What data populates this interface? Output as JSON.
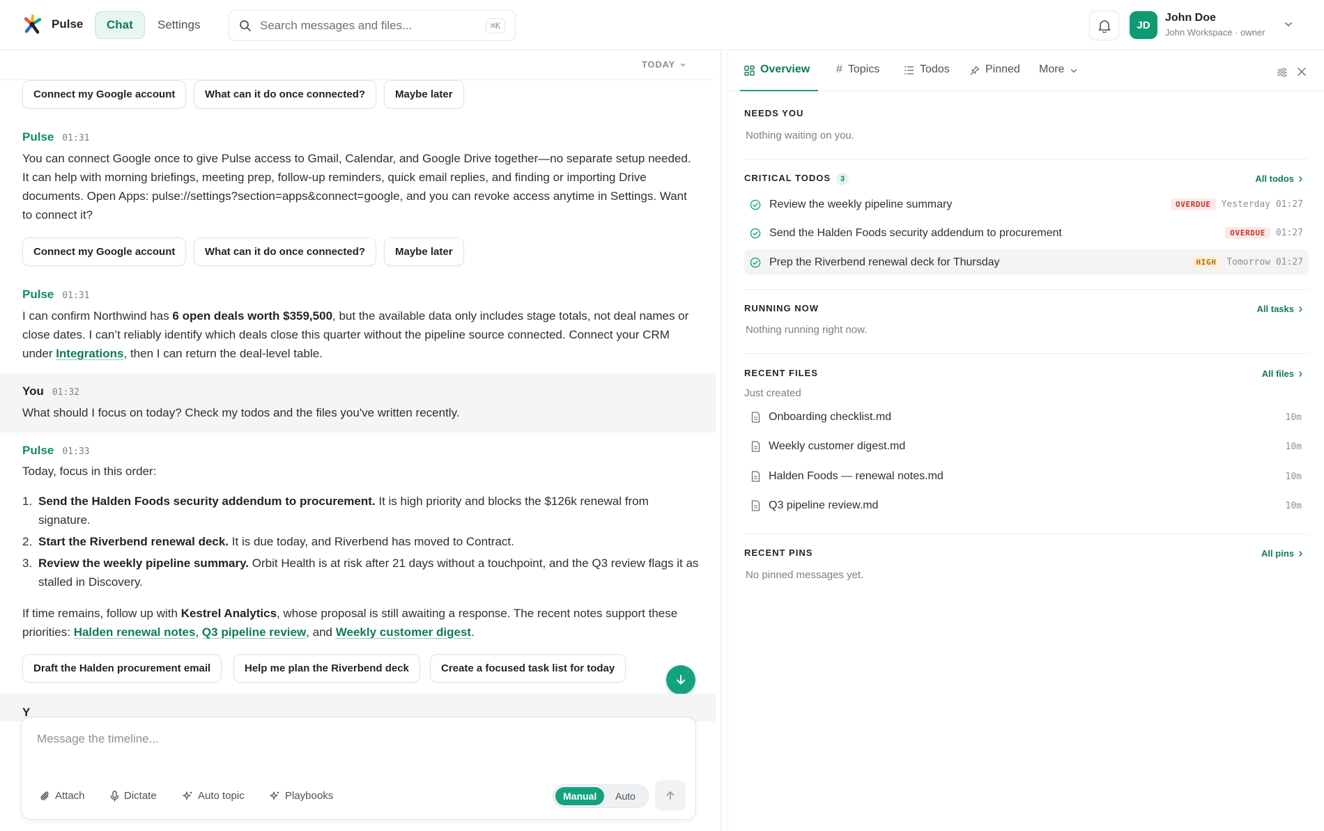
{
  "app": {
    "name": "Pulse",
    "brand_colors": [
      "#ef4b3f",
      "#f5b625",
      "#14a37e",
      "#2f64d8",
      "#1f2328"
    ]
  },
  "nav": {
    "tabs": [
      {
        "label": "Chat",
        "active": true
      },
      {
        "label": "Settings",
        "active": false
      }
    ]
  },
  "search": {
    "placeholder": "Search messages and files...",
    "shortcut": "⌘K"
  },
  "user": {
    "initials": "JD",
    "name": "John Doe",
    "subtitle": "John Workspace · owner"
  },
  "chat": {
    "date_label": "TODAY",
    "chips_top": [
      "Connect my Google account",
      "What can it do once connected?",
      "Maybe later"
    ],
    "msg1": {
      "sender": "Pulse",
      "time": "01:31",
      "text": "You can connect Google once to give Pulse access to Gmail, Calendar, and Google Drive together—no separate setup needed. It can help with morning briefings, meeting prep, follow-up reminders, quick email replies, and finding or importing Drive documents. Open Apps: pulse://settings?section=apps&connect=google, and you can revoke access anytime in Settings. Want to connect it?",
      "chips": [
        "Connect my Google account",
        "What can it do once connected?",
        "Maybe later"
      ]
    },
    "msg2": {
      "sender": "Pulse",
      "time": "01:31",
      "t1": "I can confirm Northwind has ",
      "bold": "6 open deals worth $359,500",
      "t2": ", but the available data only includes stage totals, not deal names or close dates. I can’t reliably identify which deals close this quarter without the pipeline source connected. Connect your CRM under ",
      "link": "Integrations",
      "t3": ", then I can return the deal-level table."
    },
    "msg3": {
      "sender": "You",
      "time": "01:32",
      "text": "What should I focus on today? Check my todos and the files you've written recently."
    },
    "msg4": {
      "sender": "Pulse",
      "time": "01:33",
      "intro": "Today, focus in this order:",
      "items": [
        {
          "n": "1.",
          "bold": "Send the Halden Foods security addendum to procurement.",
          "rest": " It is high priority and blocks the $126k renewal from signature."
        },
        {
          "n": "2.",
          "bold": "Start the Riverbend renewal deck.",
          "rest": " It is due today, and Riverbend has moved to Contract."
        },
        {
          "n": "3.",
          "bold": "Review the weekly pipeline summary.",
          "rest": " Orbit Health is at risk after 21 days without a touchpoint, and the Q3 review flags it as stalled in Discovery."
        }
      ],
      "outro_a": "If time remains, follow up with ",
      "outro_bold": "Kestrel Analytics",
      "outro_b": ", whose proposal is still awaiting a response. The recent notes support these priorities: ",
      "link1": "Halden renewal notes",
      "sep1": ", ",
      "link2": "Q3 pipeline review",
      "sep2": ", and ",
      "link3": "Weekly customer digest",
      "end": ".",
      "chips": [
        "Draft the Halden procurement email",
        "Help me plan the Riverbend deck",
        "Create a focused task list for today"
      ]
    },
    "partial_sender": "Y"
  },
  "composer": {
    "placeholder": "Message the timeline...",
    "tools": [
      "Attach",
      "Dictate",
      "Auto topic",
      "Playbooks"
    ],
    "modes": [
      "Manual",
      "Auto"
    ],
    "active_mode": "Manual"
  },
  "panel": {
    "tabs": [
      "Overview",
      "Topics",
      "Todos",
      "Pinned",
      "More"
    ],
    "active_tab": "Overview",
    "needs_you": {
      "title": "NEEDS YOU",
      "empty": "Nothing waiting on you."
    },
    "critical_todos": {
      "title": "CRITICAL TODOS",
      "count": "3",
      "link": "All todos",
      "items": [
        {
          "title": "Review the weekly pipeline summary",
          "badge": "OVERDUE",
          "badge_kind": "overdue",
          "when": "Yesterday 01:27"
        },
        {
          "title": "Send the Halden Foods security addendum to procurement",
          "badge": "OVERDUE",
          "badge_kind": "overdue",
          "when": "01:27"
        },
        {
          "title": "Prep the Riverbend renewal deck for Thursday",
          "badge": "HIGH",
          "badge_kind": "high",
          "when": "Tomorrow 01:27"
        }
      ]
    },
    "running_now": {
      "title": "RUNNING NOW",
      "link": "All tasks",
      "empty": "Nothing running right now."
    },
    "recent_files": {
      "title": "RECENT FILES",
      "link": "All files",
      "subtitle": "Just created",
      "items": [
        {
          "name": "Onboarding checklist.md",
          "age": "10m"
        },
        {
          "name": "Weekly customer digest.md",
          "age": "10m"
        },
        {
          "name": "Halden Foods — renewal notes.md",
          "age": "10m"
        },
        {
          "name": "Q3 pipeline review.md",
          "age": "10m"
        }
      ]
    },
    "recent_pins": {
      "title": "RECENT PINS",
      "link": "All pins",
      "empty": "No pinned messages yet."
    }
  }
}
